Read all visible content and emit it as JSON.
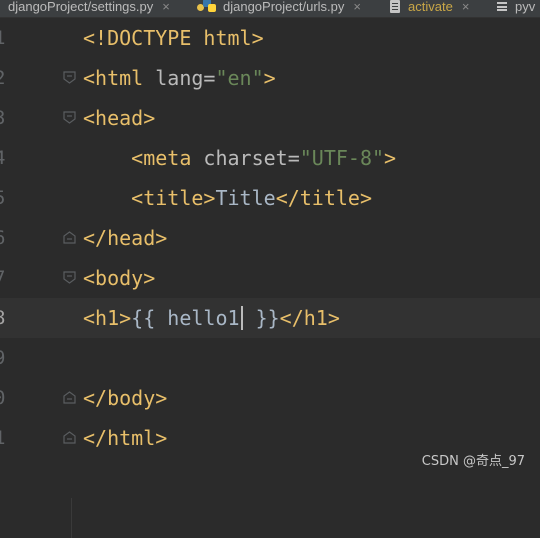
{
  "tabs": [
    {
      "label": "djangoProject/settings.py",
      "close": "×"
    },
    {
      "label": "djangoProject/urls.py",
      "close": "×"
    },
    {
      "label": "activate",
      "close": "×"
    },
    {
      "label": "pyv"
    }
  ],
  "lines": [
    {
      "number": "1",
      "parts": [
        {
          "t": "<!DOCTYPE html>",
          "c": "tag"
        }
      ]
    },
    {
      "number": "2",
      "fold": "open",
      "parts": [
        {
          "t": "<html ",
          "c": "tag"
        },
        {
          "t": "lang=",
          "c": "attr"
        },
        {
          "t": "\"en\"",
          "c": "str"
        },
        {
          "t": ">",
          "c": "tag"
        }
      ]
    },
    {
      "number": "3",
      "fold": "open",
      "parts": [
        {
          "t": "<head>",
          "c": "tag"
        }
      ]
    },
    {
      "number": "4",
      "parts": [
        {
          "t": "    ",
          "c": "plain"
        },
        {
          "t": "<meta ",
          "c": "tag"
        },
        {
          "t": "charset=",
          "c": "attr"
        },
        {
          "t": "\"UTF-8\"",
          "c": "str"
        },
        {
          "t": ">",
          "c": "tag"
        }
      ]
    },
    {
      "number": "5",
      "parts": [
        {
          "t": "    ",
          "c": "plain"
        },
        {
          "t": "<title>",
          "c": "tag"
        },
        {
          "t": "Title",
          "c": "plain"
        },
        {
          "t": "</title>",
          "c": "tag"
        }
      ]
    },
    {
      "number": "6",
      "fold": "close",
      "parts": [
        {
          "t": "</head>",
          "c": "tag"
        }
      ]
    },
    {
      "number": "7",
      "fold": "open",
      "parts": [
        {
          "t": "<body>",
          "c": "tag"
        }
      ]
    },
    {
      "number": "8",
      "current": true,
      "parts": [
        {
          "t": "<h1>",
          "c": "tag"
        },
        {
          "t": "{{ hello1",
          "c": "plain"
        },
        {
          "cursor": true
        },
        {
          "t": " }}",
          "c": "plain"
        },
        {
          "t": "</h1>",
          "c": "tag"
        }
      ]
    },
    {
      "number": "9",
      "parts": []
    },
    {
      "number": "0",
      "fold": "close",
      "parts": [
        {
          "t": "</body>",
          "c": "tag"
        }
      ]
    },
    {
      "number": "1",
      "fold": "close",
      "parts": [
        {
          "t": "</html>",
          "c": "tag"
        }
      ]
    }
  ],
  "watermark": "CSDN @奇点_97",
  "colors": {
    "background": "#2b2b2b",
    "tag": "#e8bf6a",
    "attribute": "#bababa",
    "string": "#6a8759",
    "text": "#a9b7c6"
  }
}
